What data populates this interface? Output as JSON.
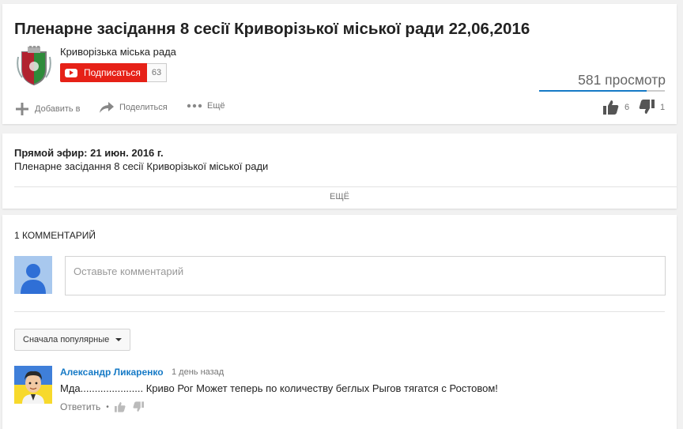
{
  "video": {
    "title": "Пленарне засідання 8 сесії Криворізької міської ради 22,06,2016",
    "channel_name": "Криворізька міська рада",
    "subscribe_label": "Подписаться",
    "subscriber_count": "63",
    "views": "581 просмотр",
    "like_ratio": 0.857
  },
  "actions": {
    "add_label": "Добавить в",
    "share_label": "Поделиться",
    "more_label": "Ещё",
    "likes": "6",
    "dislikes": "1"
  },
  "description": {
    "live_date": "Прямой эфир: 21 июн. 2016 г.",
    "text": "Пленарне засідання 8 сесії Криворізької міської ради",
    "more_label": "ЕЩЁ"
  },
  "comments": {
    "count_label": "1 комментарий",
    "input_placeholder": "Оставьте комментарий",
    "sort_label": "Сначала популярные",
    "items": [
      {
        "author": "Александр Ликаренко",
        "time": "1 день назад",
        "text": "Мда...................... Криво Рог Может теперь по количеству беглых Рыгов тягатся с Ростовом!",
        "reply_label": "Ответить"
      }
    ]
  },
  "colors": {
    "subscribe_red": "#e62117",
    "link_blue": "#167ac6",
    "text_gray": "#767676"
  }
}
